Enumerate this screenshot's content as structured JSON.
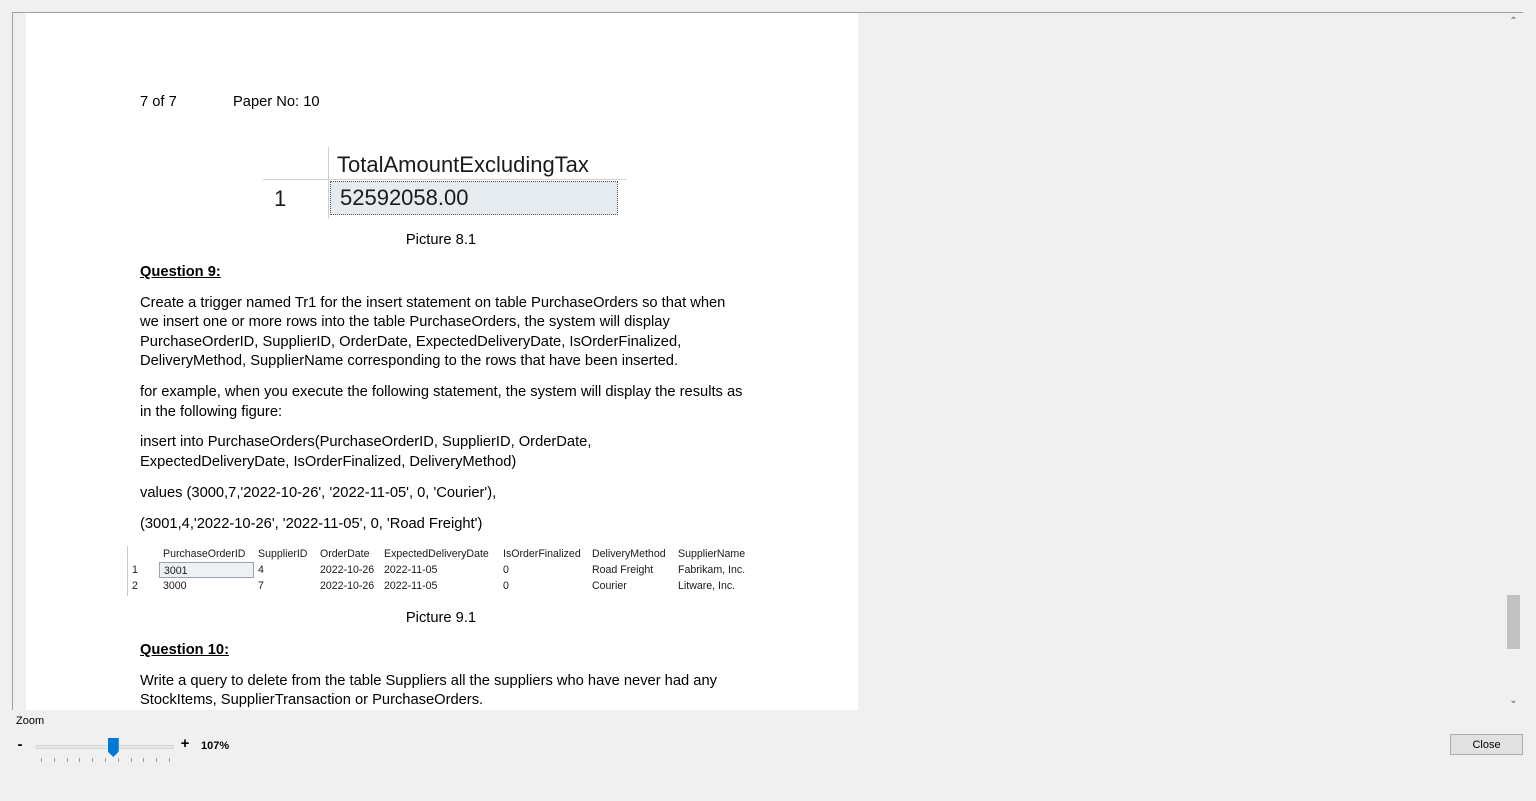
{
  "page": {
    "header_page": "7 of 7",
    "header_paper": "Paper No: 10"
  },
  "result1": {
    "column": "TotalAmountExcludingTax",
    "row_number": "1",
    "value": "52592058.00",
    "caption": "Picture 8.1"
  },
  "question9": {
    "heading": "Question 9:",
    "para1": [
      "Create a trigger named Tr1 for the insert statement on table PurchaseOrders so that when",
      "we insert one or more rows into the table PurchaseOrders, the system will display",
      "PurchaseOrderID, SupplierID, OrderDate, ExpectedDeliveryDate, IsOrderFinalized,",
      "DeliveryMethod, SupplierName corresponding to the rows that have been inserted."
    ],
    "para2": [
      "for example, when you execute the following statement, the system will display the results as",
      "in the following figure:"
    ],
    "code1": [
      "insert into PurchaseOrders(PurchaseOrderID, SupplierID, OrderDate,",
      "ExpectedDeliveryDate, IsOrderFinalized, DeliveryMethod)"
    ],
    "code2": "values (3000,7,'2022-10-26', '2022-11-05', 0, 'Courier'),",
    "code3": "(3001,4,'2022-10-26', '2022-11-05', 0, 'Road Freight')"
  },
  "result2": {
    "columns": [
      "PurchaseOrderID",
      "SupplierID",
      "OrderDate",
      "ExpectedDeliveryDate",
      "IsOrderFinalized",
      "DeliveryMethod",
      "SupplierName"
    ],
    "rows": [
      {
        "n": "1",
        "cells": [
          "3001",
          "4",
          "2022-10-26",
          "2022-11-05",
          "0",
          "Road Freight",
          "Fabrikam, Inc."
        ]
      },
      {
        "n": "2",
        "cells": [
          "3000",
          "7",
          "2022-10-26",
          "2022-11-05",
          "0",
          "Courier",
          "Litware, Inc."
        ]
      }
    ],
    "caption": "Picture 9.1"
  },
  "question10": {
    "heading": "Question 10:",
    "para1": [
      "Write a query to delete from the table Suppliers all the suppliers who have never had any",
      "StockItems, SupplierTransaction or PurchaseOrders."
    ]
  },
  "zoom": {
    "label": "Zoom",
    "minus": "-",
    "plus": "+",
    "value": "107%",
    "level_fraction": 0.56
  },
  "close_label": "Close",
  "scroll": {
    "up_glyph": "⌃",
    "down_glyph": "⌄"
  }
}
